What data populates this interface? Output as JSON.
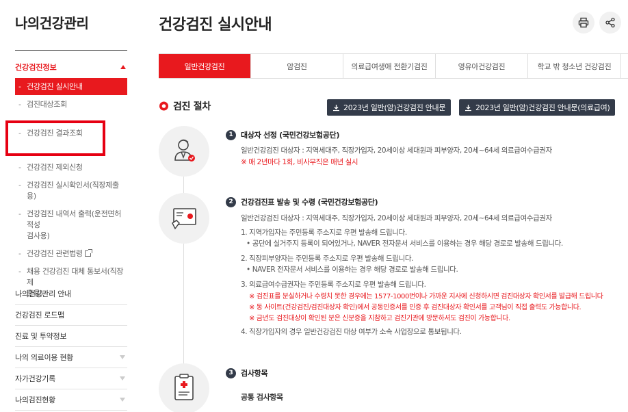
{
  "sidebar": {
    "title": "나의건강관리",
    "section_label": "건강검진정보",
    "sub_items": [
      {
        "label": "건강검진 실시안내"
      },
      {
        "label": "검진대상조회"
      },
      {
        "label": "건강검진 결과조회"
      },
      {
        "label": "건강검진 제외신청"
      },
      {
        "label": "건강검진 실시확인서(직장제출용)"
      },
      {
        "label_line1": "건강검진 내역서 출력(운전면허적성",
        "label_line2": "검사용)"
      },
      {
        "label": "건강검진 관련법령"
      },
      {
        "label_line1": "채용 건강검진 대체 통보서(직장제",
        "label_line2": "출용)"
      }
    ],
    "menu": [
      {
        "label": "나의건강관리 안내"
      },
      {
        "label": "건강검진 로드맵"
      },
      {
        "label": "진료 및 투약정보"
      },
      {
        "label": "나의 의료이용 현황"
      },
      {
        "label": "자가건강기록"
      },
      {
        "label": "나의검진현황"
      }
    ]
  },
  "header": {
    "title": "건강검진 실시안내",
    "print_icon": "printer-icon",
    "share_icon": "share-icon"
  },
  "tabs": [
    {
      "label": "일반건강검진"
    },
    {
      "label": "암검진"
    },
    {
      "label": "의료급여생애 전환기검진"
    },
    {
      "label": "영유아건강검진"
    },
    {
      "label": "학교 밖 청소년 건강검진"
    }
  ],
  "section": {
    "title": "검진 절차",
    "buttons": [
      {
        "label": "2023년 일반(암)건강검진 안내문"
      },
      {
        "label": "2023년 일반(암)건강검진 안내문(의료급여)"
      }
    ]
  },
  "steps": [
    {
      "num": "1",
      "title": "대상자 선정 (국민건강보험공단)",
      "line1": "일반건강검진 대상자 : 지역세대주, 직장가입자, 20세이상 세대원과 피부양자, 20세~64세 의료급여수급권자",
      "line2": "※ 매 2년마다 1회, 비사무직은 매년 실시"
    },
    {
      "num": "2",
      "title": "건강검진표 발송 및 수령 (국민건강보험공단)",
      "line1": "일반건강검진 대상자 : 지역세대주, 직장가입자, 20세이상 세대원과 피부양자, 20세~64세 의료급여수급권자",
      "i1": "1. 지역가입자는 주민등록 주소지로 우편 발송해 드립니다.",
      "i1a": "• 공단에 실거주지 등록이 되어있거나, NAVER 전자문서 서비스를 이용하는 경우 해당 경로로 발송해 드립니다.",
      "i2": "2. 직장피부양자는 주민등록 주소지로 우편 발송해 드립니다.",
      "i2a": "• NAVER 전자문서 서비스를 이용하는 경우 해당 경로로 발송해 드립니다.",
      "i3": "3. 의료급여수급권자는 주민등록 주소지로 우편 발송해 드립니다.",
      "n1": "※ 검진표를 분실하거나 수령치 못한 경우에는 1577-1000번이나 가까운 지사에 신청하시면 검진대상자 확인서를 발급해 드립니다",
      "n2": "※ 동 사이트(건강검진/검진대상자 확인)에서 공동인증서를 인증 후 검진대상자 확인서를 고객님이 직접 출력도 가능합니다.",
      "n3": "※ 금년도 검진대상이 확인된 분은 신분증을 지참하고 검진기관에 방문하셔도 검진이 가능합니다.",
      "i4": "4. 직장가입자의 경우 일반건강검진 대상 여부가 소속 사업장으로 통보됩니다."
    },
    {
      "num": "3",
      "title": "검사항목",
      "sub": "공통 검사항목"
    }
  ],
  "colors": {
    "accent": "#e8191e",
    "dark_button": "#333b49",
    "highlight": "#e60012"
  }
}
